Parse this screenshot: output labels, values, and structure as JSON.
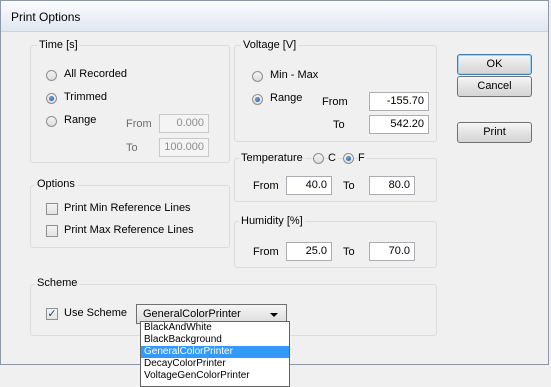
{
  "window": {
    "title": "Print Options"
  },
  "time": {
    "label": "Time [s]",
    "options": [
      "All Recorded",
      "Trimmed",
      "Range"
    ],
    "selected": 1,
    "from_label": "From",
    "to_label": "To",
    "from_value": "0.000",
    "to_value": "100.000"
  },
  "voltage": {
    "label": "Voltage [V]",
    "options": [
      "Min - Max",
      "Range"
    ],
    "selected": 1,
    "from_label": "From",
    "to_label": "To",
    "from_value": "-155.70",
    "to_value": "542.20"
  },
  "temperature": {
    "label": "Temperature",
    "unit_c": "C",
    "unit_f": "F",
    "selected_unit": "F",
    "from_label": "From",
    "to_label": "To",
    "from_value": "40.0",
    "to_value": "80.0"
  },
  "humidity": {
    "label": "Humidity [%]",
    "from_label": "From",
    "to_label": "To",
    "from_value": "25.0",
    "to_value": "70.0"
  },
  "options": {
    "label": "Options",
    "items": [
      {
        "label": "Print Min Reference Lines",
        "checked": false
      },
      {
        "label": "Print Max Reference Lines",
        "checked": false
      }
    ]
  },
  "scheme": {
    "label": "Scheme",
    "use_scheme_label": "Use Scheme",
    "use_scheme_checked": true,
    "selected": "GeneralColorPrinter",
    "list": [
      "BlackAndWhite",
      "BlackBackground",
      "GeneralColorPrinter",
      "DecayColorPrinter",
      "VoltageGenColorPrinter"
    ]
  },
  "buttons": {
    "ok": "OK",
    "cancel": "Cancel",
    "print": "Print"
  }
}
